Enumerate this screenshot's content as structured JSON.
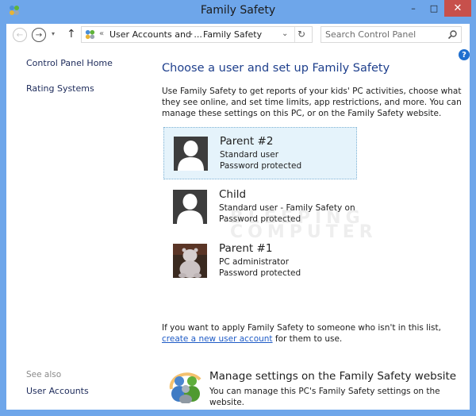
{
  "window": {
    "title": "Family Safety",
    "app_icon": "family-safety-icon",
    "controls": {
      "minimize": "–",
      "maximize": "□",
      "close": "✕"
    }
  },
  "toolbar": {
    "back_icon": "←",
    "forward_icon": "→",
    "recent_icon": "▾",
    "up_icon": "↑",
    "address": {
      "overflow": "«",
      "crumbs": [
        "User Accounts and ...",
        "Family Safety"
      ],
      "separator": "▸",
      "dropdown_icon": "⌄",
      "refresh_icon": "↻"
    },
    "search": {
      "placeholder": "Search Control Panel",
      "value": ""
    }
  },
  "sidebar": {
    "links": [
      {
        "label": "Control Panel Home"
      },
      {
        "label": "Rating Systems"
      }
    ],
    "see_also_label": "See also",
    "see_also_links": [
      {
        "label": "User Accounts"
      }
    ]
  },
  "help_icon": "?",
  "main": {
    "heading": "Choose a user and set up Family Safety",
    "intro": "Use Family Safety to get reports of your kids' PC activities, choose what they see online, and set time limits, app restrictions, and more. You can manage these settings on this PC, or on the Family Safety website.",
    "users": [
      {
        "name": "Parent #2",
        "line1": "Standard user",
        "line2": "Password protected",
        "selected": true,
        "avatar": "default-user"
      },
      {
        "name": "Child",
        "line1": "Standard user - Family Safety on",
        "line2": "Password protected",
        "selected": false,
        "avatar": "default-user"
      },
      {
        "name": "Parent #1",
        "line1": "PC administrator",
        "line2": "Password protected",
        "selected": false,
        "avatar": "hippo-photo"
      }
    ],
    "watermark": "BLEEPING\nCOMPUTER",
    "note_before": "If you want to apply Family Safety to someone who isn't in this list, ",
    "note_link": "create a new user account",
    "note_after": " for them to use.",
    "manage": {
      "title": "Manage settings on the Family Safety website",
      "desc": "You can manage this PC's Family Safety settings on the website."
    }
  },
  "colors": {
    "frame": "#6ea6ea",
    "close": "#c7504b",
    "heading": "#1e3f8c",
    "link": "#1e5bc6",
    "selected_tile": "#e5f3fb"
  }
}
